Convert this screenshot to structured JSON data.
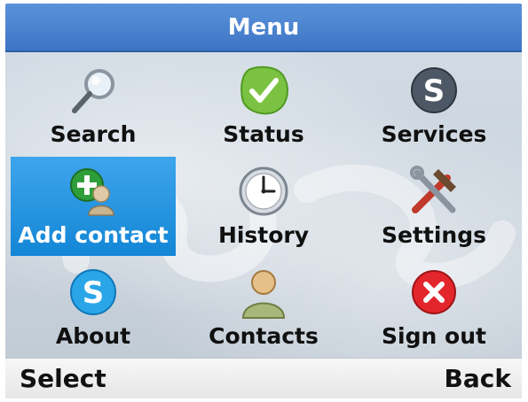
{
  "header": {
    "title": "Menu"
  },
  "menu": {
    "items": [
      {
        "label": "Search",
        "icon": "search-icon"
      },
      {
        "label": "Status",
        "icon": "status-check-icon"
      },
      {
        "label": "Services",
        "icon": "skype-services-icon"
      },
      {
        "label": "Add contact",
        "icon": "add-contact-icon",
        "selected": true
      },
      {
        "label": "History",
        "icon": "clock-icon"
      },
      {
        "label": "Settings",
        "icon": "tools-icon"
      },
      {
        "label": "About",
        "icon": "skype-about-icon"
      },
      {
        "label": "Contacts",
        "icon": "contact-person-icon"
      },
      {
        "label": "Sign out",
        "icon": "sign-out-icon"
      }
    ]
  },
  "softkeys": {
    "left": "Select",
    "right": "Back"
  },
  "colors": {
    "title_bar": "#4a84d0",
    "selected_cell": "#1e8fdd",
    "softkey_bar": "#efefef"
  }
}
